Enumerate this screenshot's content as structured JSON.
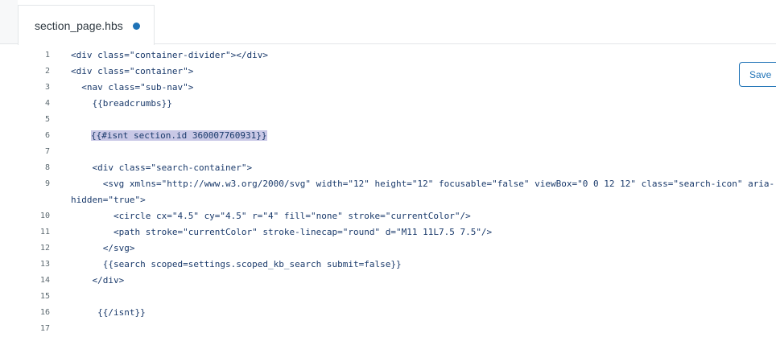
{
  "tab": {
    "label": "section_page.hbs",
    "unsaved_indicator": "dot-icon"
  },
  "toolbar": {
    "save_label": "Save"
  },
  "editor": {
    "lines": [
      {
        "num": "1",
        "text": "<div class=\"container-divider\"></div>"
      },
      {
        "num": "2",
        "text": "<div class=\"container\">"
      },
      {
        "num": "3",
        "text": "  <nav class=\"sub-nav\">"
      },
      {
        "num": "4",
        "text": "    {{breadcrumbs}}"
      },
      {
        "num": "5",
        "text": ""
      },
      {
        "num": "6",
        "text": "    {{#isnt section.id 360007760931}}"
      },
      {
        "num": "7",
        "text": ""
      },
      {
        "num": "8",
        "text": "    <div class=\"search-container\">"
      },
      {
        "num": "9",
        "text": "      <svg xmlns=\"http://www.w3.org/2000/svg\" width=\"12\" height=\"12\" focusable=\"false\" viewBox=\"0 0 12 12\" class=\"search-icon\" aria-"
      },
      {
        "num": "",
        "text": "hidden=\"true\">"
      },
      {
        "num": "10",
        "text": "        <circle cx=\"4.5\" cy=\"4.5\" r=\"4\" fill=\"none\" stroke=\"currentColor\"/>"
      },
      {
        "num": "11",
        "text": "        <path stroke=\"currentColor\" stroke-linecap=\"round\" d=\"M11 11L7.5 7.5\"/>"
      },
      {
        "num": "12",
        "text": "      </svg>"
      },
      {
        "num": "13",
        "text": "      {{search scoped=settings.scoped_kb_search submit=false}}"
      },
      {
        "num": "14",
        "text": "    </div>"
      },
      {
        "num": "15",
        "text": ""
      },
      {
        "num": "16",
        "text": "     {{/isnt}}"
      },
      {
        "num": "17",
        "text": ""
      }
    ]
  },
  "colors": {
    "accent": "#1f73b7",
    "selection": "#c9c8e6"
  }
}
